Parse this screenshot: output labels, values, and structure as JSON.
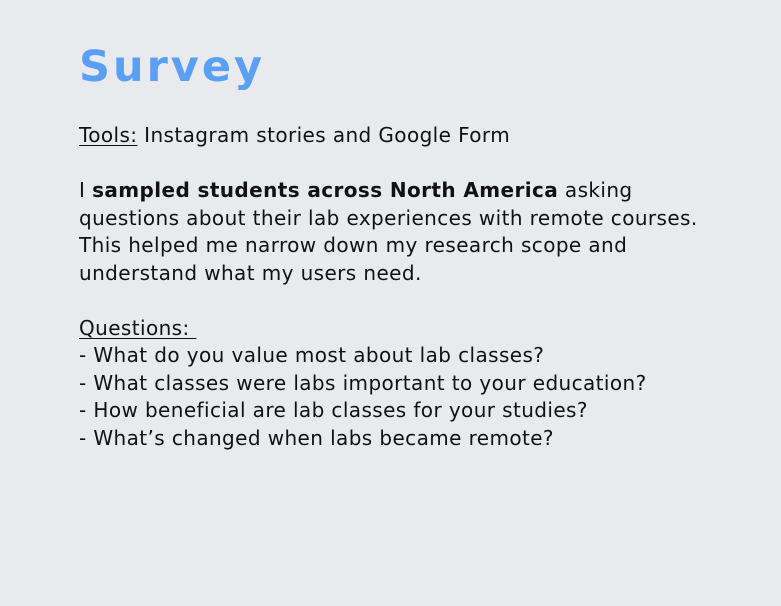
{
  "title": "Survey",
  "tools": {
    "label": "Tools:",
    "text": " Instagram stories and Google Form"
  },
  "summary": {
    "prefix": "I ",
    "emphasis": "sampled students across North America",
    "rest": " asking questions about their lab experiences with remote courses. This helped me narrow down my research scope and understand what my users need."
  },
  "questions": {
    "heading": "Questions: ",
    "items": [
      "- What do you value most about lab classes?",
      "- What classes were labs important to your education?",
      "- How beneficial are lab classes for your studies?",
      "- What’s changed when labs became remote?"
    ]
  }
}
